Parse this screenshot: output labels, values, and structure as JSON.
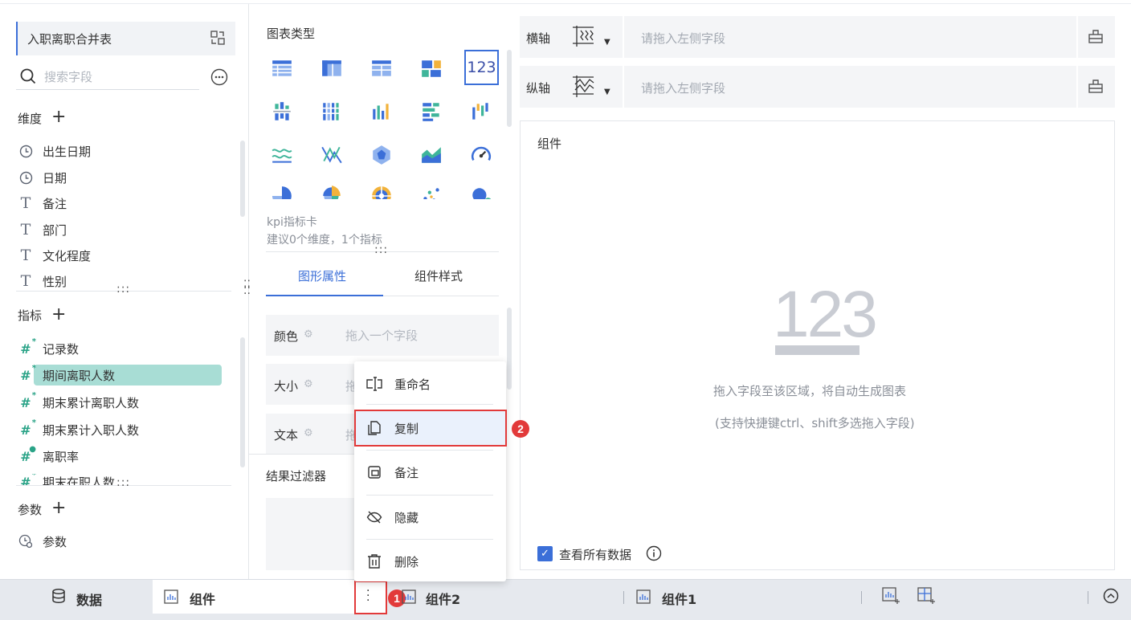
{
  "dataset": {
    "name": "入职离职合并表"
  },
  "search": {
    "placeholder": "搜索字段"
  },
  "dimensions": {
    "title": "维度",
    "items": [
      {
        "label": "出生日期",
        "icon": "clock-icon"
      },
      {
        "label": "日期",
        "icon": "clock-icon"
      },
      {
        "label": "备注",
        "icon": "text-type-icon"
      },
      {
        "label": "部门",
        "icon": "text-type-icon"
      },
      {
        "label": "文化程度",
        "icon": "text-type-icon"
      },
      {
        "label": "性别",
        "icon": "text-type-icon"
      }
    ]
  },
  "metrics": {
    "title": "指标",
    "items": [
      {
        "label": "记录数"
      },
      {
        "label": "期间离职人数",
        "selected": true
      },
      {
        "label": "期末累计离职人数"
      },
      {
        "label": "期末累计入职人数"
      },
      {
        "label": "离职率"
      },
      {
        "label": "期末在职人数"
      }
    ]
  },
  "params": {
    "title": "参数",
    "items": [
      {
        "label": "参数"
      }
    ]
  },
  "chart_types": {
    "title": "图表类型",
    "selected": "123",
    "current_name": "kpi指标卡",
    "current_desc": "建议0个维度，1个指标"
  },
  "props_tabs": [
    {
      "label": "图形属性",
      "active": true
    },
    {
      "label": "组件样式",
      "active": false
    }
  ],
  "props": {
    "color": {
      "label": "颜色",
      "placeholder": "拖入一个字段"
    },
    "size": {
      "label": "大小",
      "placeholder": "拖"
    },
    "text": {
      "label": "文本",
      "placeholder": "拖"
    }
  },
  "filter": {
    "title": "结果过滤器"
  },
  "axis": {
    "x": {
      "label": "横轴",
      "placeholder": "请拖入左侧字段"
    },
    "y": {
      "label": "纵轴",
      "placeholder": "请拖入左侧字段"
    }
  },
  "component": {
    "title": "组件",
    "placeholder_number": "123",
    "hint1": "拖入字段至该区域，将自动生成图表",
    "hint2": "(支持快捷键ctrl、shift多选拖入字段)",
    "show_all_label": "查看所有数据",
    "show_all_checked": true
  },
  "context_menu": {
    "items": [
      {
        "label": "重命名",
        "icon": "rename-icon"
      },
      {
        "label": "复制",
        "icon": "copy-icon",
        "highlighted": true
      },
      {
        "label": "备注",
        "icon": "note-icon"
      },
      {
        "label": "隐藏",
        "icon": "eye-hidden-icon"
      },
      {
        "label": "删除",
        "icon": "trash-icon"
      }
    ]
  },
  "bottom_tabs": {
    "data_label": "数据",
    "tabs": [
      {
        "label": "组件",
        "active": true
      },
      {
        "label": "组件2"
      },
      {
        "label": "组件1"
      }
    ]
  },
  "annotations": {
    "badge1": "1",
    "badge2": "2"
  },
  "colors": {
    "accent": "#3b6fd8",
    "teal": "#2aa387",
    "annotation_red": "#e23a3a",
    "selected_bg": "#a8ddd5"
  }
}
